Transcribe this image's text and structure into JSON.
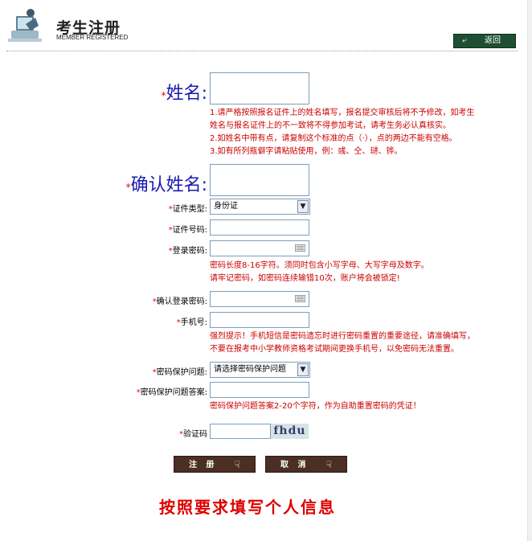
{
  "header": {
    "title_cn": "考生注册",
    "title_en": "MEMBER REGISTERED",
    "back_label": "返回"
  },
  "form": {
    "name": {
      "label": "姓名:",
      "value": ""
    },
    "name_notes": [
      "1.请严格按照报名证件上的姓名填写，报名提交审核后将不予修改，如考生",
      "姓名与报名证件上的不一致将不得参加考试，请考生务必认真核实。",
      "2.如姓名中带有点，请复制这个标准的点（·），点的两边不能有空格。",
      "3.如有所列瓶僻字请粘贴使用，例：彧、仝、琎、铧。"
    ],
    "confirm_name": {
      "label": "确认姓名:",
      "value": ""
    },
    "id_type": {
      "label": "证件类型:",
      "value": "身份证"
    },
    "id_number": {
      "label": "证件号码:",
      "value": ""
    },
    "password": {
      "label": "登录密码:",
      "value": ""
    },
    "password_notes": [
      "密码长度8-16字符。须同时包含小写字母、大写字母及数字。",
      "请牢记密码，如密码连续输错10次，账户将会被锁定!"
    ],
    "confirm_password": {
      "label": "确认登录密码:",
      "value": ""
    },
    "phone": {
      "label": "手机号:",
      "value": ""
    },
    "phone_notes": [
      "强烈提示！手机短信是密码遗忘时进行密码重置的重要途径，请准确填写，",
      "不要在报考中小学教师资格考试期间更换手机号，以免密码无法重置。"
    ],
    "security_question": {
      "label": "密码保护问题:",
      "value": "请选择密码保护问题"
    },
    "security_answer": {
      "label": "密码保护问题答案:",
      "value": ""
    },
    "security_notes": [
      "密码保护问题答案2-20个字符，作为自助重置密码的凭证！"
    ],
    "captcha": {
      "label": "验证码",
      "value": "",
      "image_text": "fhdu"
    },
    "star": "*"
  },
  "buttons": {
    "register": "注 册",
    "cancel": "取 消"
  },
  "caption": "按照要求填写个人信息",
  "colors": {
    "required_star": "#ee0000",
    "note_text": "#cc0000",
    "big_label": "#1a1ab0",
    "back_button_bg": "#1e4f32",
    "action_button_bg": "#4a2f22",
    "caption": "#dd0000"
  },
  "icons": {
    "logo": "computer-user-icon",
    "back": "back-arrow-icon",
    "keyboard": "keyboard-icon",
    "hand_cursor": "hand-pointer-icon",
    "dropdown": "chevron-down-icon"
  }
}
